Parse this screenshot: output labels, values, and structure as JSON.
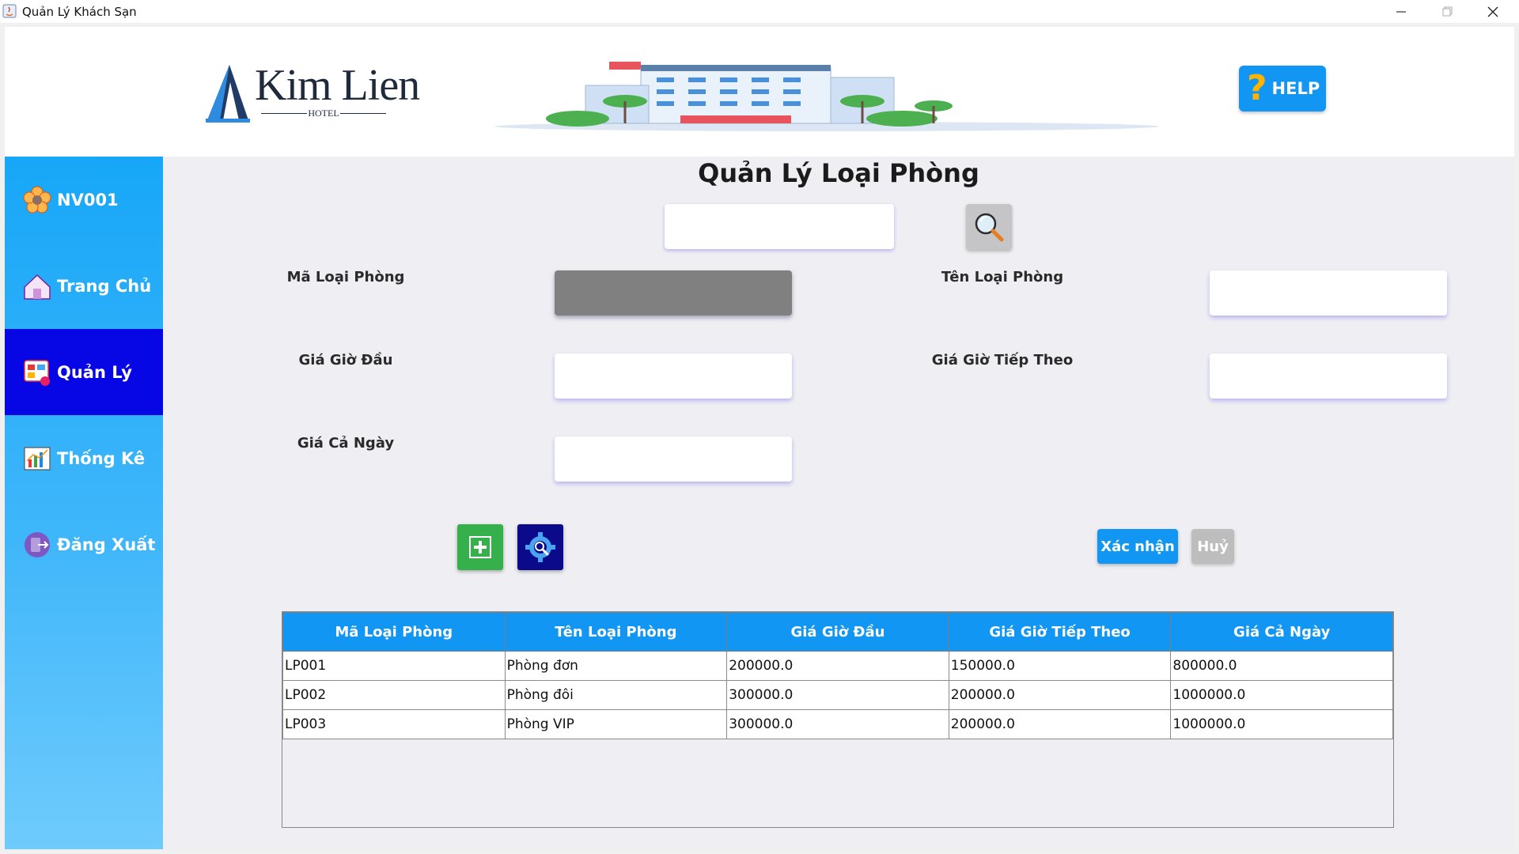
{
  "window": {
    "title": "Quản Lý Khách Sạn",
    "controls": [
      "minimize-icon",
      "maximize-icon",
      "close-icon"
    ]
  },
  "header": {
    "logo_name": "Kim Lien",
    "logo_sub": "HOTEL",
    "help_label": "HELP",
    "help_icon": "question-icon"
  },
  "sidebar": {
    "items": [
      {
        "label": "NV001",
        "icon": "user-flower-icon",
        "active": false
      },
      {
        "label": "Trang Chủ",
        "icon": "home-icon",
        "active": false
      },
      {
        "label": "Quản Lý",
        "icon": "management-icon",
        "active": true
      },
      {
        "label": "Thống Kê",
        "icon": "statistics-icon",
        "active": false
      },
      {
        "label": "Đăng Xuất",
        "icon": "logout-icon",
        "active": false
      }
    ]
  },
  "main": {
    "title": "Quản Lý Loại Phòng",
    "search": {
      "value": "",
      "placeholder": ""
    },
    "fields": {
      "ma_loai_phong": {
        "label": "Mã Loại Phòng",
        "value": "",
        "disabled": true
      },
      "ten_loai_phong": {
        "label": "Tên Loại Phòng",
        "value": ""
      },
      "gia_gio_dau": {
        "label": "Giá Giờ Đầu",
        "value": ""
      },
      "gia_gio_tiep_theo": {
        "label": "Giá Giờ Tiếp Theo",
        "value": ""
      },
      "gia_ca_ngay": {
        "label": "Giá Cả Ngày",
        "value": ""
      }
    },
    "actions": {
      "add_icon": "plus-icon",
      "edit_icon": "settings-search-icon",
      "confirm_label": "Xác nhận",
      "cancel_label": "Huỷ"
    },
    "table": {
      "columns": [
        "Mã Loại Phòng",
        "Tên Loại Phòng",
        "Giá Giờ Đầu",
        "Giá Giờ Tiếp Theo",
        "Giá Cả Ngày"
      ],
      "rows": [
        [
          "LP001",
          "Phòng đơn",
          "200000.0",
          "150000.0",
          "800000.0"
        ],
        [
          "LP002",
          "Phòng đôi",
          "300000.0",
          "200000.0",
          "1000000.0"
        ],
        [
          "LP003",
          "Phòng VIP",
          "300000.0",
          "200000.0",
          "1000000.0"
        ]
      ]
    }
  },
  "colors": {
    "accent": "#1196f3",
    "sidebar_active": "#0707e6",
    "add_button": "#36b04a",
    "edit_button": "#0a0a8a"
  }
}
